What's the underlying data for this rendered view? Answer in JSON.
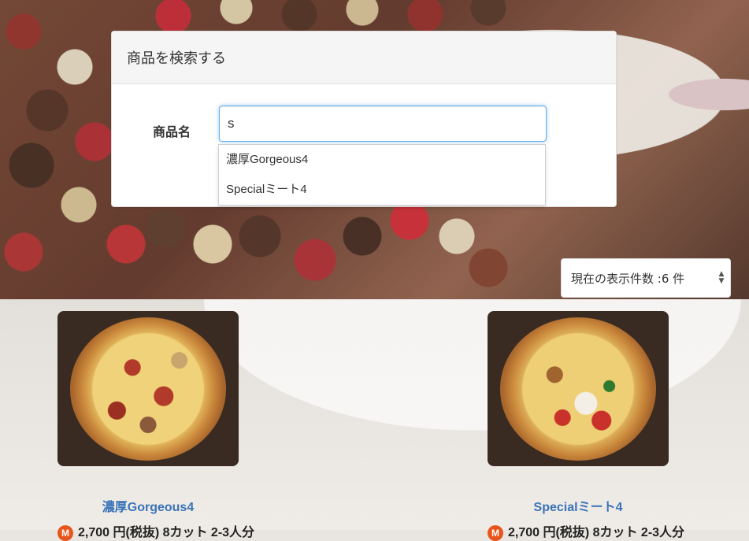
{
  "search": {
    "title": "商品を検索する",
    "field_label": "商品名",
    "input_value": "s",
    "suggestions": [
      "濃厚Gorgeous4",
      "Specialミート4"
    ]
  },
  "page_size": {
    "selected": "現在の表示件数 :6 件"
  },
  "products": [
    {
      "name": "濃厚Gorgeous4",
      "size": "M",
      "price_text": "2,700 円(税抜) 8カット 2-3人分"
    },
    {
      "name": "Specialミート4",
      "size": "M",
      "price_text": "2,700 円(税抜) 8カット 2-3人分"
    }
  ],
  "colors": {
    "link_blue": "#3a73b7",
    "badge_orange": "#e8551c",
    "focus_blue": "#66afe9"
  }
}
